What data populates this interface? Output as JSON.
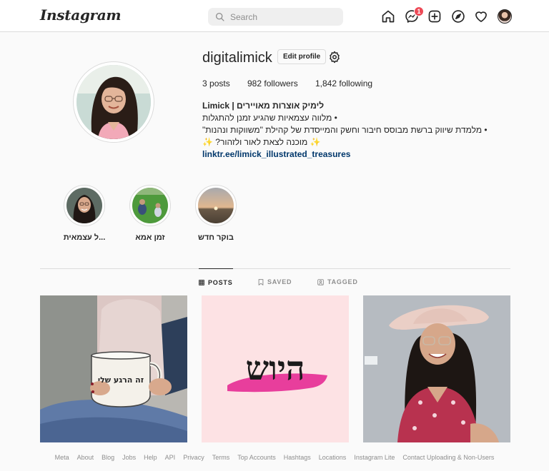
{
  "app": {
    "logo": "Instagram",
    "search_placeholder": "Search",
    "messages_badge": "1",
    "icons": [
      "home-icon",
      "messenger-icon",
      "new-post-icon",
      "explore-icon",
      "activity-heart-icon",
      "profile-avatar"
    ]
  },
  "profile": {
    "username": "digitalimick",
    "edit_label": "Edit profile",
    "stats": {
      "posts_count": "3",
      "posts_label": "posts",
      "followers_count": "982",
      "followers_label": "followers",
      "following_count": "1,842",
      "following_label": "following"
    },
    "bio_name": "לימיק אוצרות מאויירים | Limick",
    "bio_lines": [
      "• מלווה עצמאיות שהגיע זמנן להתגלות",
      "• מלמדת שיווק ברשת מבוסס חיבור וחשק והמייסדת של קהילת \"משווקות ונהנות\"",
      "✨ מוכנה לצאת לאור ולזהור? ✨"
    ],
    "link": "linktr.ee/limick_illustrated_treasures"
  },
  "highlights": [
    {
      "label": "...ל עצמאית"
    },
    {
      "label": "זמן אמא"
    },
    {
      "label": "בוקר חדש"
    }
  ],
  "tabs": [
    {
      "label": "POSTS",
      "active": true
    },
    {
      "label": "SAVED",
      "active": false
    },
    {
      "label": "TAGGED",
      "active": false
    }
  ],
  "posts": [
    {
      "caption_on_image": "זה הרגע שלי"
    },
    {
      "caption_on_image": "היוש"
    },
    {
      "caption_on_image": ""
    }
  ],
  "footer": [
    "Meta",
    "About",
    "Blog",
    "Jobs",
    "Help",
    "API",
    "Privacy",
    "Terms",
    "Top Accounts",
    "Hashtags",
    "Locations",
    "Instagram Lite",
    "Contact Uploading & Non-Users"
  ],
  "colors": {
    "link": "#00376b",
    "badge": "#ed4956",
    "border": "#dbdbdb",
    "brand_pink": "#e83e9c"
  }
}
